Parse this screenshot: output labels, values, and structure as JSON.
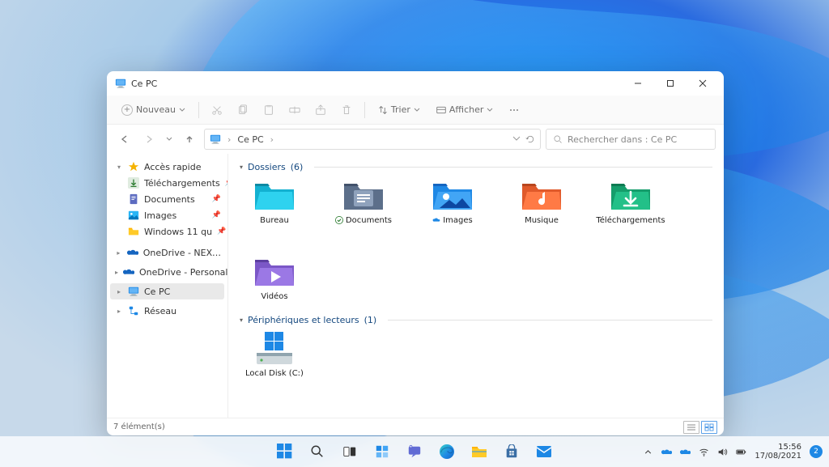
{
  "window": {
    "title": "Ce PC",
    "new_button": "Nouveau",
    "sort_label": "Trier",
    "view_label": "Afficher"
  },
  "address": {
    "crumb": "Ce PC",
    "search_placeholder": "Rechercher dans : Ce PC"
  },
  "sidebar": {
    "quick_access": "Accès rapide",
    "items": [
      {
        "label": "Téléchargements"
      },
      {
        "label": "Documents"
      },
      {
        "label": "Images"
      },
      {
        "label": "Windows 11  qu"
      }
    ],
    "onedrive1": "OneDrive - NEXTRAI",
    "onedrive2": "OneDrive - Personal",
    "this_pc": "Ce PC",
    "network": "Réseau"
  },
  "groups": {
    "folders": {
      "title": "Dossiers",
      "count": "(6)"
    },
    "drives": {
      "title": "Périphériques et lecteurs",
      "count": "(1)"
    }
  },
  "folders": [
    {
      "label": "Bureau"
    },
    {
      "label": "Documents",
      "badge": "sync"
    },
    {
      "label": "Images",
      "badge": "cloud"
    },
    {
      "label": "Musique"
    },
    {
      "label": "Téléchargements"
    },
    {
      "label": "Vidéos"
    }
  ],
  "drives": [
    {
      "label": "Local Disk (C:)"
    }
  ],
  "status": {
    "text": "7 élément(s)"
  },
  "taskbar": {
    "time": "15:56",
    "date": "17/08/2021",
    "notif_count": "2"
  }
}
